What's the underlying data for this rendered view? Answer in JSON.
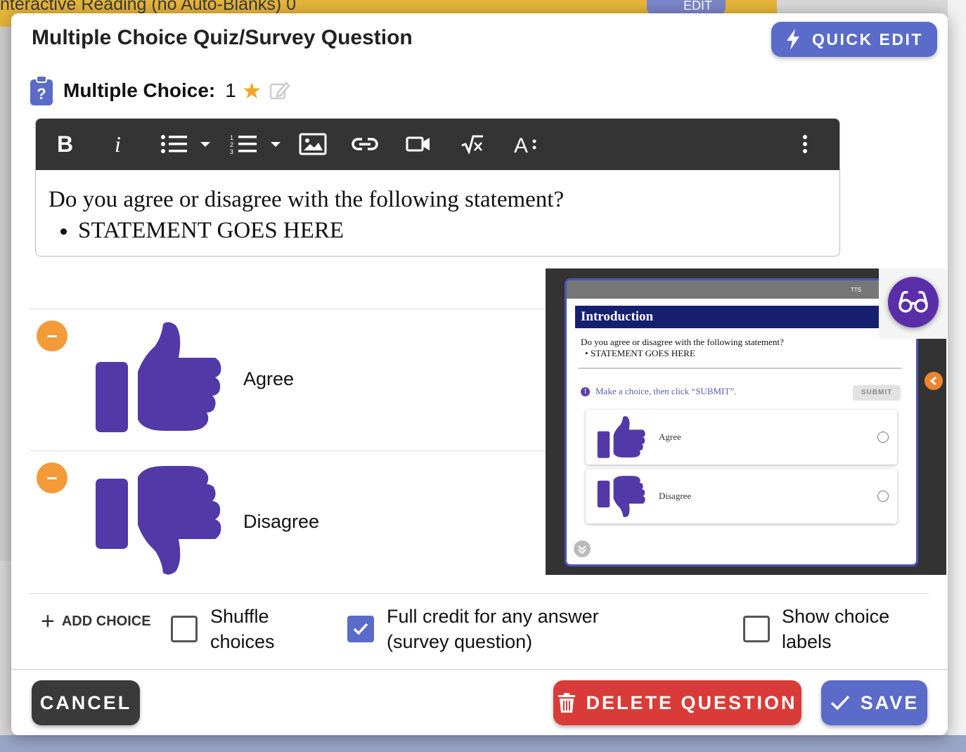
{
  "background": {
    "topbar_text": "nteractive Reading (no Auto-Blanks)  0",
    "edit_label": "EDIT"
  },
  "modal": {
    "title": "Multiple Choice Quiz/Survey Question",
    "quick_edit_label": "QUICK EDIT",
    "question_type_label": "Multiple Choice:",
    "points": "1"
  },
  "editor": {
    "toolbar_icons": [
      "bold-icon",
      "italic-icon",
      "bulleted-list-icon",
      "numbered-list-icon",
      "image-icon",
      "link-icon",
      "video-icon",
      "math-icon",
      "text-style-icon",
      "more-icon"
    ],
    "question_text": "Do you agree or disagree with the following statement?",
    "bullet_text": "STATEMENT GOES HERE"
  },
  "choices": [
    {
      "label": "Agree",
      "icon": "thumbs-up-icon"
    },
    {
      "label": "Disagree",
      "icon": "thumbs-down-icon"
    }
  ],
  "preview": {
    "tts_label": "TTS",
    "section_title": "Introduction",
    "question_text": "Do you agree or disagree with the following statement?",
    "bullet_text": "STATEMENT GOES HERE",
    "hint_text": "Make a choice, then click “SUBMIT”.",
    "submit_label": "SUBMIT",
    "choices": [
      {
        "label": "Agree"
      },
      {
        "label": "Disagree"
      }
    ]
  },
  "options": {
    "add_choice_label": "ADD CHOICE",
    "shuffle_line1": "Shuffle",
    "shuffle_line2": "choices",
    "shuffle_checked": false,
    "full_credit_line1": "Full credit for any answer",
    "full_credit_line2": "(survey question)",
    "full_credit_checked": true,
    "show_labels_line1": "Show choice",
    "show_labels_line2": "labels",
    "show_labels_checked": false
  },
  "footer": {
    "cancel_label": "CANCEL",
    "delete_label": "DELETE QUESTION",
    "save_label": "SAVE"
  },
  "colors": {
    "primary": "#5b6bc9",
    "danger": "#d93c38",
    "thumb": "#5338a8",
    "remove": "#f29b38",
    "star": "#f5a623"
  }
}
